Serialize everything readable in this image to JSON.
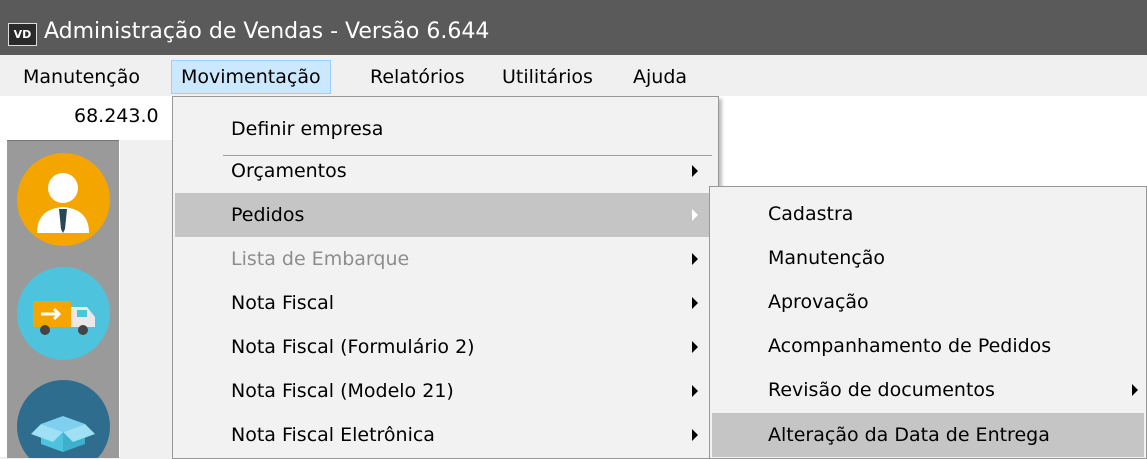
{
  "window": {
    "app_icon": "VD",
    "title": "Administração de Vendas - Versão 6.644"
  },
  "menubar": [
    {
      "label": "Manutenção"
    },
    {
      "label": "Movimentação"
    },
    {
      "label": "Relatórios"
    },
    {
      "label": "Utilitários"
    },
    {
      "label": "Ajuda"
    }
  ],
  "amount_text": "68.243.0",
  "movimentacao_menu": {
    "items": [
      {
        "label": "Definir empresa",
        "submenu": false,
        "disabled": false
      },
      {
        "label": "Orçamentos",
        "submenu": true,
        "disabled": false
      },
      {
        "label": "Pedidos",
        "submenu": true,
        "disabled": false,
        "highlighted": true
      },
      {
        "label": "Lista de Embarque",
        "submenu": true,
        "disabled": true
      },
      {
        "label": "Nota Fiscal",
        "submenu": true,
        "disabled": false
      },
      {
        "label": "Nota Fiscal (Formulário 2)",
        "submenu": true,
        "disabled": false
      },
      {
        "label": "Nota Fiscal (Modelo 21)",
        "submenu": true,
        "disabled": false
      },
      {
        "label": "Nota Fiscal Eletrônica",
        "submenu": true,
        "disabled": false
      }
    ]
  },
  "pedidos_submenu": {
    "items": [
      {
        "label": "Cadastra",
        "submenu": false
      },
      {
        "label": "Manutenção",
        "submenu": false
      },
      {
        "label": "Aprovação",
        "submenu": false
      },
      {
        "label": "Acompanhamento de Pedidos",
        "submenu": false
      },
      {
        "label": "Revisão de documentos",
        "submenu": true
      },
      {
        "label": "Alteração da Data de Entrega",
        "submenu": false,
        "highlighted": true
      }
    ]
  },
  "side_icons": [
    "user-icon",
    "delivery-truck-icon",
    "box-icon"
  ],
  "colors": {
    "titlebar": "#5a5a5a",
    "menu_highlight": "#c5c5c5",
    "menubar_active": "#cce8ff"
  }
}
